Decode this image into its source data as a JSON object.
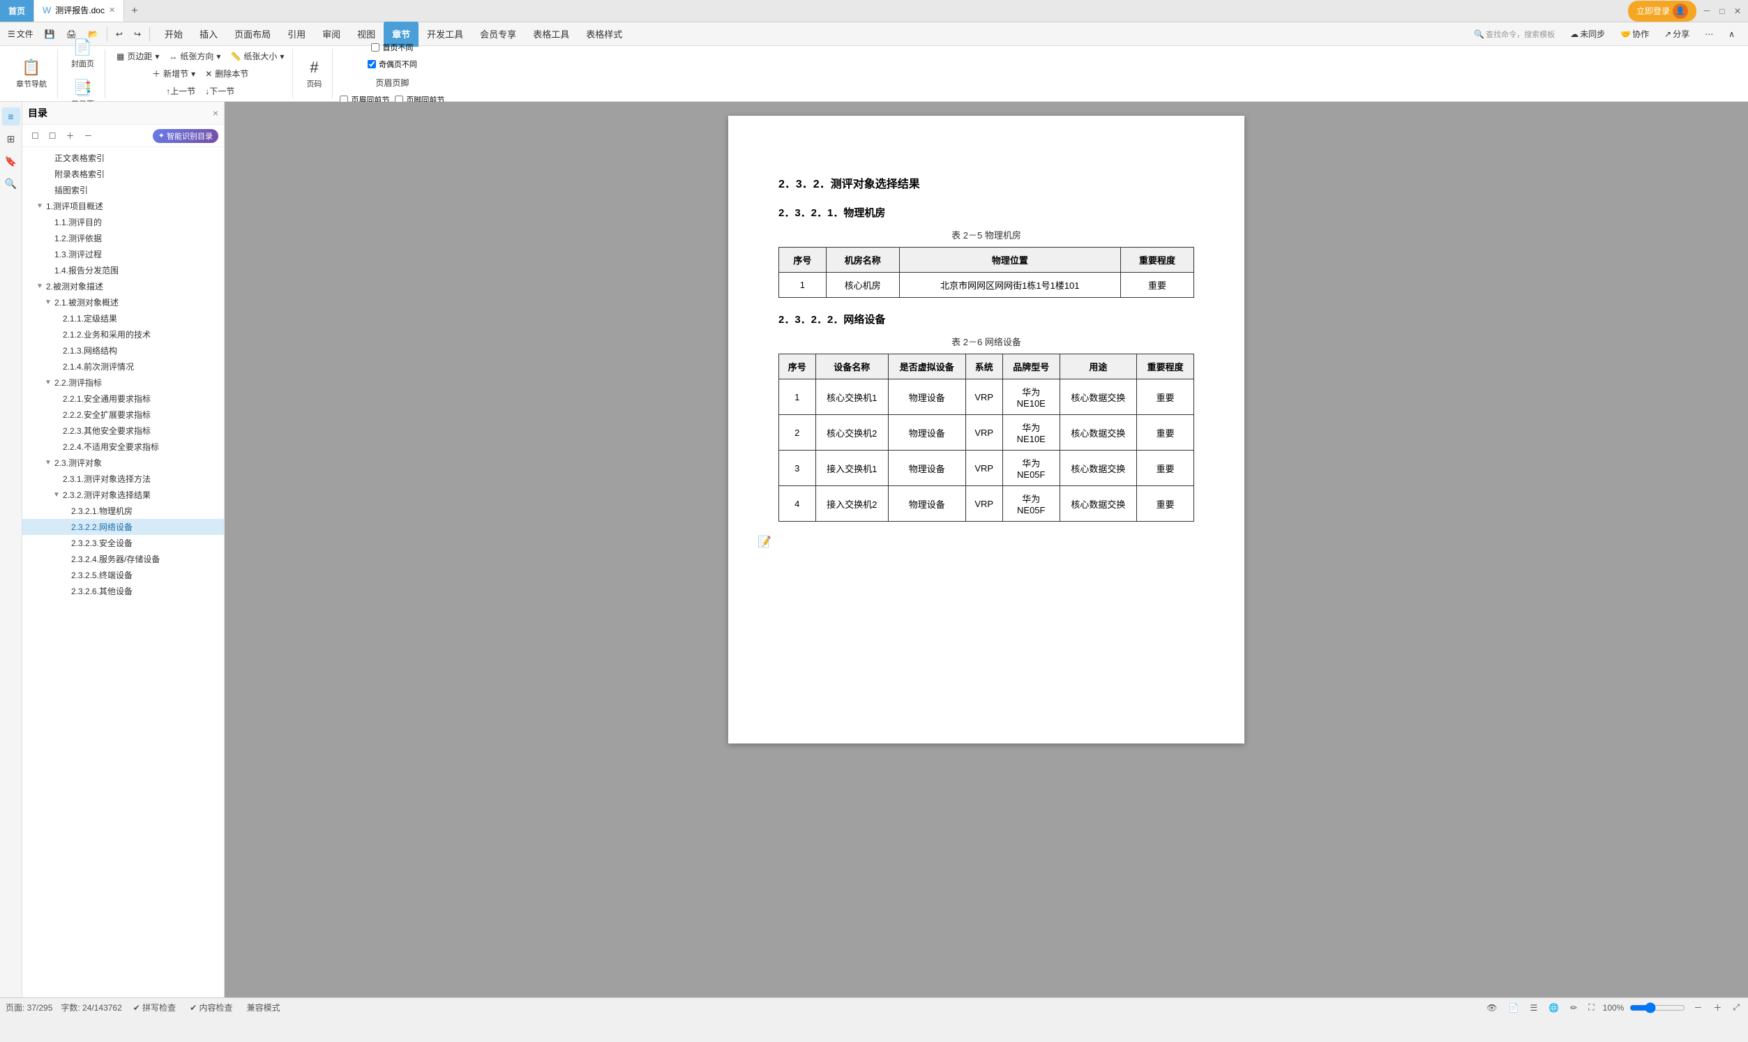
{
  "tabs": {
    "home": "首页",
    "doc": "测评报告.doc",
    "add": "+"
  },
  "toolbar": {
    "file": "文件",
    "undo": "↩",
    "redo": "↪",
    "buttons": [
      "开始",
      "插入",
      "页面布局",
      "引用",
      "审阅",
      "视图",
      "章节",
      "开发工具",
      "会员专享",
      "表格工具",
      "表格样式"
    ]
  },
  "ribbon_chapter": {
    "nav_label": "章节导航",
    "cover_label": "封面页",
    "toc_label": "目录页",
    "margin_label": "页边距",
    "orientation_label": "纸张方向",
    "size_label": "纸张大小",
    "add_section_label": "新增节",
    "delete_section_label": "删除本节",
    "prev_section_label": "↑上一节",
    "next_section_label": "↓下一节",
    "page_num_label": "页码",
    "header_diff_label": "首页不同",
    "odd_even_diff_label": "奇偶页不同",
    "header_footer_label": "页眉页脚",
    "header_same_prev_label": "页眉同前节",
    "footer_same_prev_label": "页脚同前节"
  },
  "sidebar": {
    "title": "目录",
    "close": "×",
    "ai_label": "智能识别目录",
    "tools": [
      "☐",
      "☐",
      "＋",
      "－"
    ],
    "items": [
      {
        "level": 3,
        "text": "正文表格索引",
        "toggle": ""
      },
      {
        "level": 3,
        "text": "附录表格索引",
        "toggle": ""
      },
      {
        "level": 3,
        "text": "插图索引",
        "toggle": ""
      },
      {
        "level": 2,
        "text": "1.测评项目概述",
        "toggle": "▼"
      },
      {
        "level": 3,
        "text": "1.1.测评目的",
        "toggle": ""
      },
      {
        "level": 3,
        "text": "1.2.测评依据",
        "toggle": ""
      },
      {
        "level": 3,
        "text": "1.3.测评过程",
        "toggle": ""
      },
      {
        "level": 3,
        "text": "1.4.报告分发范围",
        "toggle": ""
      },
      {
        "level": 2,
        "text": "2.被测对象描述",
        "toggle": "▼"
      },
      {
        "level": 3,
        "text": "2.1.被测对象概述",
        "toggle": "▼"
      },
      {
        "level": 4,
        "text": "2.1.1.定级结果",
        "toggle": ""
      },
      {
        "level": 4,
        "text": "2.1.2.业务和采用的技术",
        "toggle": ""
      },
      {
        "level": 4,
        "text": "2.1.3.网络结构",
        "toggle": ""
      },
      {
        "level": 4,
        "text": "2.1.4.前次测评情况",
        "toggle": ""
      },
      {
        "level": 3,
        "text": "2.2.测评指标",
        "toggle": "▼"
      },
      {
        "level": 4,
        "text": "2.2.1.安全通用要求指标",
        "toggle": ""
      },
      {
        "level": 4,
        "text": "2.2.2.安全扩展要求指标",
        "toggle": ""
      },
      {
        "level": 4,
        "text": "2.2.3.其他安全要求指标",
        "toggle": ""
      },
      {
        "level": 4,
        "text": "2.2.4.不适用安全要求指标",
        "toggle": ""
      },
      {
        "level": 3,
        "text": "2.3.测评对象",
        "toggle": "▼"
      },
      {
        "level": 4,
        "text": "2.3.1.测评对象选择方法",
        "toggle": ""
      },
      {
        "level": 4,
        "text": "2.3.2.测评对象选择结果",
        "toggle": "▼"
      },
      {
        "level": 5,
        "text": "2.3.2.1.物理机房",
        "toggle": ""
      },
      {
        "level": 5,
        "text": "2.3.2.2.网络设备",
        "toggle": "",
        "active": true
      },
      {
        "level": 5,
        "text": "2.3.2.3.安全设备",
        "toggle": ""
      },
      {
        "level": 5,
        "text": "2.3.2.4.服务器/存储设备",
        "toggle": ""
      },
      {
        "level": 5,
        "text": "2.3.2.5.终端设备",
        "toggle": ""
      },
      {
        "level": 5,
        "text": "2.3.2.6.其他设备",
        "toggle": ""
      }
    ]
  },
  "document": {
    "section_232": "2．3．2．测评对象选择结果",
    "section_2321": "2．3．2．1．物理机房",
    "table5_caption": "表 2－5 物理机房",
    "table5_headers": [
      "序号",
      "机房名称",
      "物理位置",
      "重要程度"
    ],
    "table5_rows": [
      {
        "seq": "1",
        "name": "核心机房",
        "location": "北京市网网区网网街1栋1号1楼101",
        "importance": "重要"
      }
    ],
    "section_2322": "2．3．2．2．网络设备",
    "table6_caption": "表 2－6 网络设备",
    "table6_headers": [
      "序号",
      "设备名称",
      "是否虚拟设备",
      "系统",
      "品牌型号",
      "用途",
      "重要程度"
    ],
    "table6_rows": [
      {
        "seq": "1",
        "name": "核心交换机1",
        "virtual": "物理设备",
        "system": "VRP",
        "brand": "华为\nNE10E",
        "usage": "核心数据交换",
        "importance": "重要"
      },
      {
        "seq": "2",
        "name": "核心交换机2",
        "virtual": "物理设备",
        "system": "VRP",
        "brand": "华为\nNE10E",
        "usage": "核心数据交换",
        "importance": "重要"
      },
      {
        "seq": "3",
        "name": "接入交换机1",
        "virtual": "物理设备",
        "system": "VRP",
        "brand": "华为\nNE05F",
        "usage": "核心数据交换",
        "importance": "重要"
      },
      {
        "seq": "4",
        "name": "接入交换机2",
        "virtual": "物理设备",
        "system": "VRP",
        "brand": "华为\nNE05F",
        "usage": "核心数据交换",
        "importance": "重要"
      }
    ]
  },
  "status": {
    "page_info": "页面: 37/295",
    "word_count": "字数: 24/143762",
    "spell_check": "✔ 拼写检查",
    "content_check": "✔ 内容检查",
    "compat_mode": "兼容模式",
    "zoom": "100%"
  },
  "header_right": {
    "sync": "未同步",
    "collab": "协作",
    "share": "分享",
    "search_placeholder": "查找命令，搜索模板",
    "login": "立即登录"
  }
}
